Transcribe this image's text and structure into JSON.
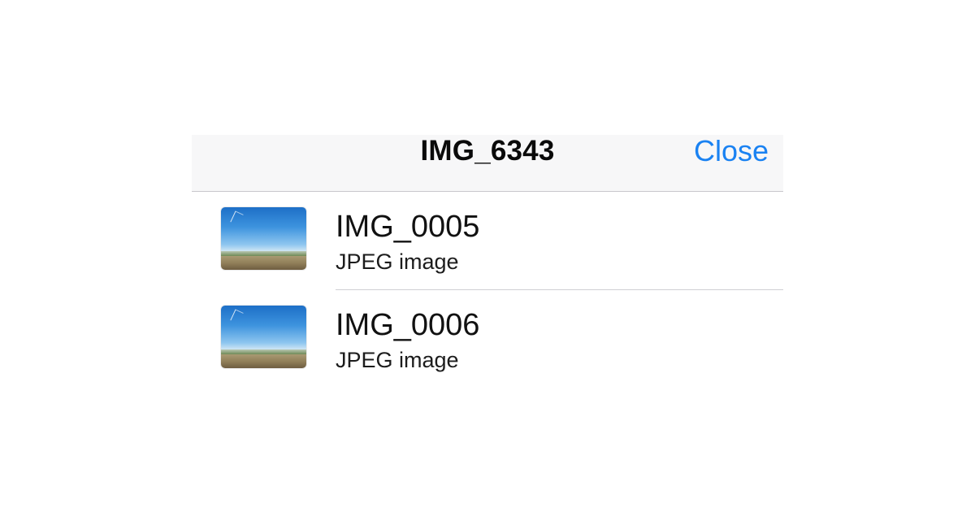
{
  "nav": {
    "title": "IMG_6343",
    "close_label": "Close",
    "accent_color": "#1a82f2"
  },
  "files": [
    {
      "name": "IMG_0005",
      "type": "JPEG image",
      "thumbnail_icon": "landscape-photo-thumbnail"
    },
    {
      "name": "IMG_0006",
      "type": "JPEG image",
      "thumbnail_icon": "landscape-photo-thumbnail"
    }
  ]
}
